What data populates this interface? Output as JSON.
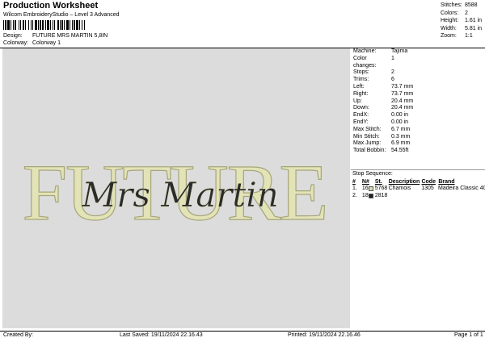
{
  "header": {
    "title": "Production Worksheet",
    "subtitle": "Wilcom EmbroideryStudio – Level 3 Advanced",
    "design_label": "Design:",
    "design_value": "FUTURE MRS MARTIN 5,8IN",
    "colorway_label": "Colorway:",
    "colorway_value": "Colorway 1"
  },
  "stats": [
    {
      "label": "Stitches:",
      "value": "8588"
    },
    {
      "label": "Colors:",
      "value": "2"
    },
    {
      "label": "Height:",
      "value": "1.61 in"
    },
    {
      "label": "Width:",
      "value": "5.81 in"
    },
    {
      "label": "Zoom:",
      "value": "1:1"
    }
  ],
  "design": {
    "word_main": "FUTURE",
    "word_script": "Mrs Martin",
    "main_color": "#e3e3b8",
    "main_stroke": "#a6a67a",
    "script_color": "#2b2b2b"
  },
  "properties": [
    {
      "label": "Machine:",
      "value": "Tajima"
    },
    {
      "label": "Color changes:",
      "value": "1"
    },
    {
      "label": "Stops:",
      "value": "2"
    },
    {
      "label": "Trims:",
      "value": "6"
    },
    {
      "label": "Left:",
      "value": "73.7 mm"
    },
    {
      "label": "Right:",
      "value": "73.7 mm"
    },
    {
      "label": "Up:",
      "value": "20.4 mm"
    },
    {
      "label": "Down:",
      "value": "20.4 mm"
    },
    {
      "label": "EndX:",
      "value": "0.00 in"
    },
    {
      "label": "EndY:",
      "value": "0.00 in"
    },
    {
      "label": "Max Stitch:",
      "value": "6.7 mm"
    },
    {
      "label": "Min Stitch:",
      "value": "0.3 mm"
    },
    {
      "label": "Max Jump:",
      "value": "6.9 mm"
    },
    {
      "label": "Total Bobbin:",
      "value": "54.55ft"
    }
  ],
  "stop_sequence": {
    "title": "Stop Sequence:",
    "headers": [
      "#",
      "N#",
      "St.",
      "Description",
      "Code",
      "Brand"
    ],
    "rows": [
      {
        "idx": "1.",
        "n": "16",
        "swatch": "#d9d9ad",
        "st": "5768",
        "desc": "Chamois",
        "code": "1305",
        "brand": "Madeira Classic 40"
      },
      {
        "idx": "2.",
        "n": "18",
        "swatch": "#1e1e1e",
        "st": "2818",
        "desc": "",
        "code": "",
        "brand": ""
      }
    ]
  },
  "footer": {
    "created_by": "Created By:",
    "last_saved": "Last Saved: 19/11/2024 22.16.43",
    "printed": "Printed: 19/11/2024 22.16.46",
    "page": "Page 1 of 1"
  }
}
